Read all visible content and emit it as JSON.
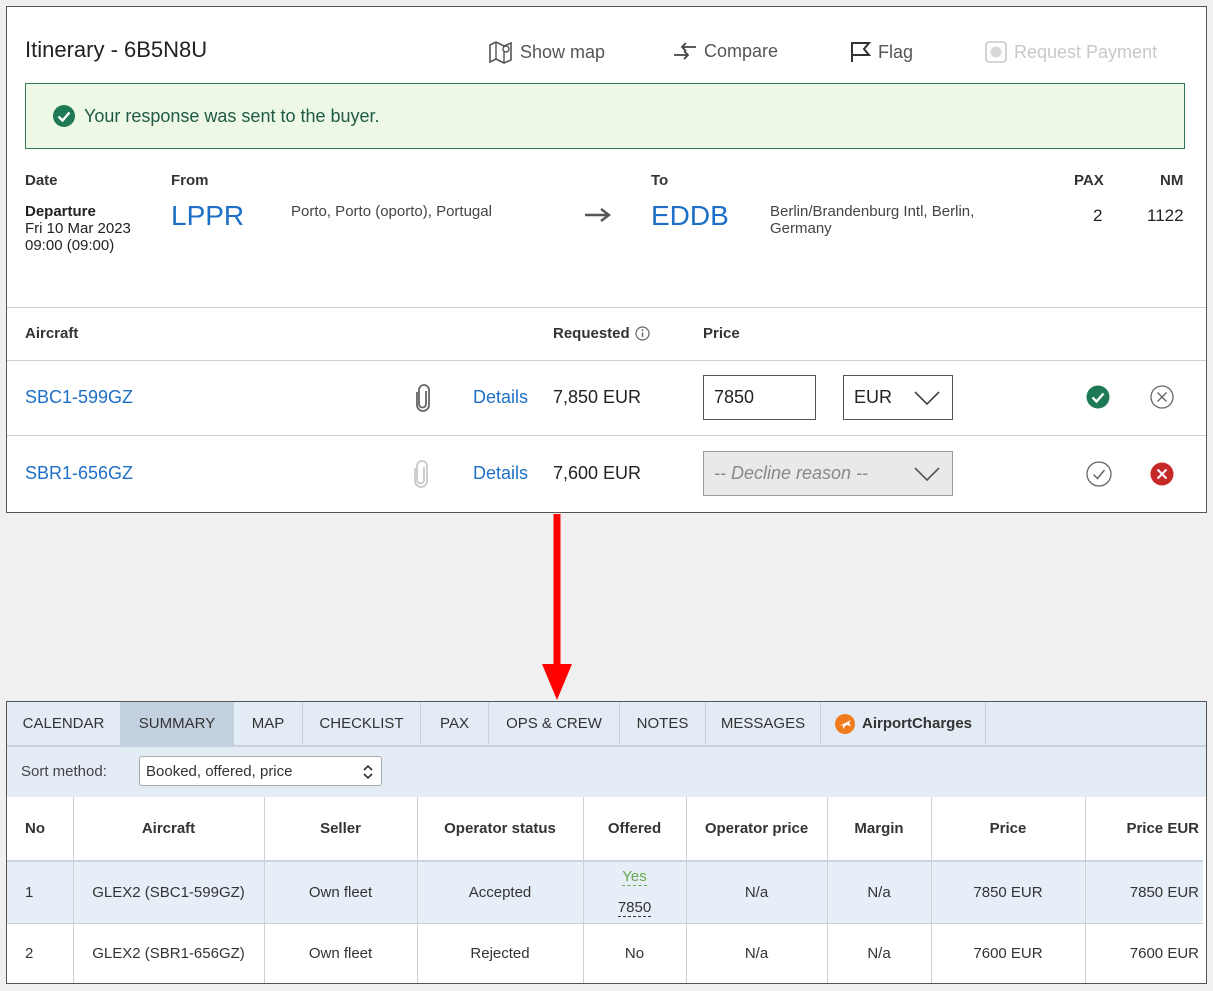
{
  "itinerary": {
    "title": "Itinerary - 6B5N8U",
    "actions": {
      "show_map": "Show map",
      "compare": "Compare",
      "flag": "Flag",
      "request_payment": "Request Payment"
    },
    "alert": "Your response was sent to the buyer.",
    "labels": {
      "date": "Date",
      "from": "From",
      "to": "To",
      "pax": "PAX",
      "nm": "NM"
    },
    "leg": {
      "type": "Departure",
      "date": "Fri 10 Mar 2023",
      "time": "09:00 (09:00)",
      "from_code": "LPPR",
      "from_name": "Porto, Porto (oporto), Portugal",
      "to_code": "EDDB",
      "to_name_line1": "Berlin/Brandenburg Intl, Berlin,",
      "to_name_line2": "Germany",
      "pax": "2",
      "nm": "1122"
    },
    "aircraft_header": {
      "aircraft": "Aircraft",
      "requested": "Requested",
      "price": "Price"
    },
    "aircraft": [
      {
        "reg": "SBC1-599GZ",
        "details": "Details",
        "requested": "7,850 EUR",
        "price": "7850",
        "currency": "EUR"
      },
      {
        "reg": "SBR1-656GZ",
        "details": "Details",
        "requested": "7,600 EUR",
        "decline_placeholder": "-- Decline reason --"
      }
    ]
  },
  "summary": {
    "tabs": [
      "CALENDAR",
      "SUMMARY",
      "MAP",
      "CHECKLIST",
      "PAX",
      "OPS & CREW",
      "NOTES",
      "MESSAGES",
      "AirportCharges"
    ],
    "active_tab": "SUMMARY",
    "sort_label": "Sort method:",
    "sort_value": "Booked, offered, price",
    "columns": [
      "No",
      "Aircraft",
      "Seller",
      "Operator status",
      "Offered",
      "Operator price",
      "Margin",
      "Price",
      "Price EUR"
    ],
    "rows": [
      {
        "no": "1",
        "aircraft": "GLEX2 (SBC1-599GZ)",
        "seller": "Own fleet",
        "status": "Accepted",
        "offered": "Yes",
        "offered_value": "7850",
        "operator_price": "N/a",
        "margin": "N/a",
        "price": "7850 EUR",
        "price_eur": "7850 EUR"
      },
      {
        "no": "2",
        "aircraft": "GLEX2 (SBR1-656GZ)",
        "seller": "Own fleet",
        "status": "Rejected",
        "offered": "No",
        "operator_price": "N/a",
        "margin": "N/a",
        "price": "7600 EUR",
        "price_eur": "7600 EUR"
      }
    ]
  },
  "colors": {
    "link_blue": "#1e6fc7",
    "success_green": "#1d7a55",
    "decline_red": "#c62828",
    "accepted_green": "#6aa84f",
    "rejected_red": "#d04040",
    "arrow_red": "#ff0000"
  }
}
